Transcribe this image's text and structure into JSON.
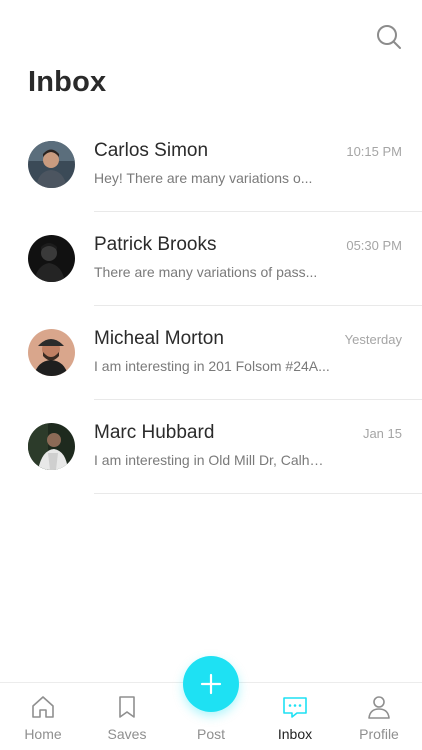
{
  "header": {
    "title": "Inbox",
    "search_icon": "search-icon"
  },
  "messages": [
    {
      "name": "Carlos Simon",
      "time": "10:15 PM",
      "preview": "Hey! There are many variations o..."
    },
    {
      "name": "Patrick Brooks",
      "time": "05:30 PM",
      "preview": "There are many variations of pass..."
    },
    {
      "name": "Micheal Morton",
      "time": "Yesterday",
      "preview": "I am interesting  in 201 Folsom #24A..."
    },
    {
      "name": "Marc Hubbard",
      "time": "Jan 15",
      "preview": "I am interesting  in Old Mill Dr, Calhoun..."
    }
  ],
  "tabs": [
    {
      "label": "Home",
      "icon": "home-icon"
    },
    {
      "label": "Saves",
      "icon": "bookmark-icon"
    },
    {
      "label": "Post",
      "icon": "plus-icon"
    },
    {
      "label": "Inbox",
      "icon": "chat-icon",
      "active": true
    },
    {
      "label": "Profile",
      "icon": "user-icon"
    }
  ],
  "colors": {
    "accent": "#1ee1f3",
    "text": "#2b2b2b",
    "muted": "#7a7a7a",
    "time": "#a5a5a5"
  }
}
